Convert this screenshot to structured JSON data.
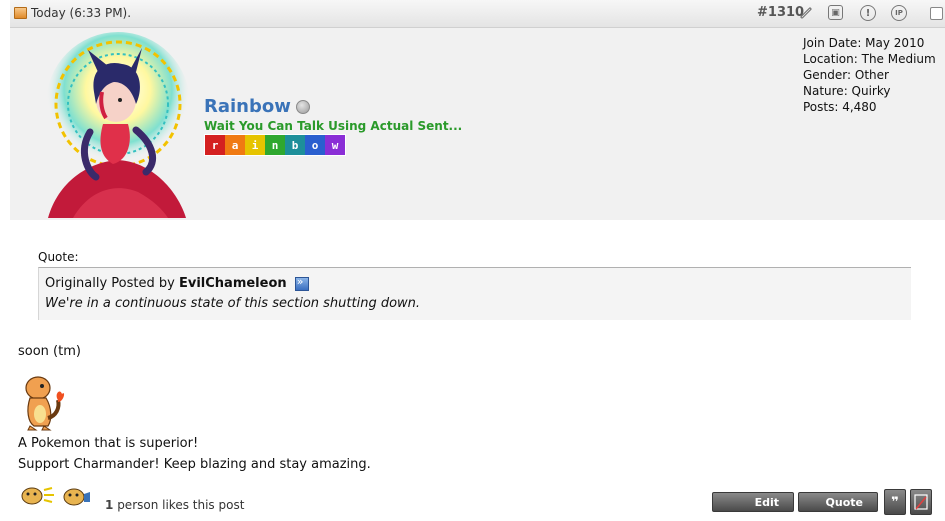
{
  "post": {
    "date": "Today (6:33 PM).",
    "number": "#1310"
  },
  "user": {
    "name": "Rainbow",
    "title": "Wait You Can Talk Using Actual Sent...",
    "rainbow_letters": [
      "r",
      "a",
      "i",
      "n",
      "b",
      "o",
      "w"
    ],
    "rainbow_colors": [
      "#d42020",
      "#f07a12",
      "#e6c400",
      "#2fa82f",
      "#1d8f9a",
      "#2a5fcf",
      "#8a2ed6"
    ],
    "info": {
      "join_date": "Join Date: May 2010",
      "location": "Location: The Medium",
      "gender": "Gender: Other",
      "nature": "Nature: Quirky",
      "posts": "Posts: 4,480"
    }
  },
  "quote": {
    "label": "Quote:",
    "posted_by_prefix": "Originally Posted by",
    "author": "EvilChameleon",
    "text": "We're in a continuous state of this section shutting down."
  },
  "message": "soon (tm)",
  "signature": {
    "line1": "A Pokemon that is superior!",
    "line2": "Support Charmander! Keep blazing and stay amazing."
  },
  "likes": {
    "count": "1",
    "text": "person likes this post"
  },
  "buttons": {
    "edit": "Edit",
    "quote": "Quote"
  },
  "icons": [
    "link-icon",
    "report-hex-icon",
    "warn-icon",
    "ip-icon",
    "multiquote-icon",
    "delete-icon"
  ]
}
